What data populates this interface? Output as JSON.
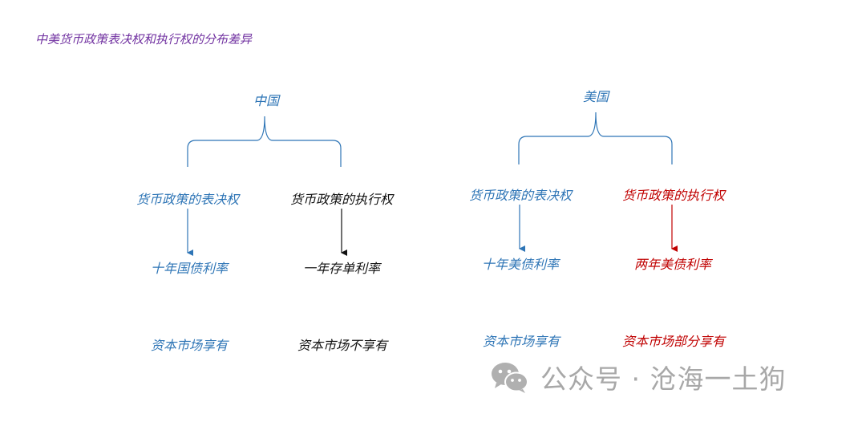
{
  "title": "中美货币政策表决权和执行权的分布差异",
  "china": {
    "label": "中国",
    "left": {
      "power": "货币政策的表决权",
      "rate": "十年国债利率",
      "market": "资本市场享有"
    },
    "right": {
      "power": "货币政策的执行权",
      "rate": "一年存单利率",
      "market": "资本市场不享有"
    }
  },
  "usa": {
    "label": "美国",
    "left": {
      "power": "货币政策的表决权",
      "rate": "十年美债利率",
      "market": "资本市场享有"
    },
    "right": {
      "power": "货币政策的执行权",
      "rate": "两年美债利率",
      "market": "资本市场部分享有"
    }
  },
  "watermark": {
    "text": "公众号 · 沧海一土狗",
    "icon": "wechat-icon"
  },
  "colors": {
    "title": "#7030a0",
    "blue": "#2e75b6",
    "black": "#111111",
    "red": "#c00000",
    "watermark": "#a8a8a8"
  }
}
